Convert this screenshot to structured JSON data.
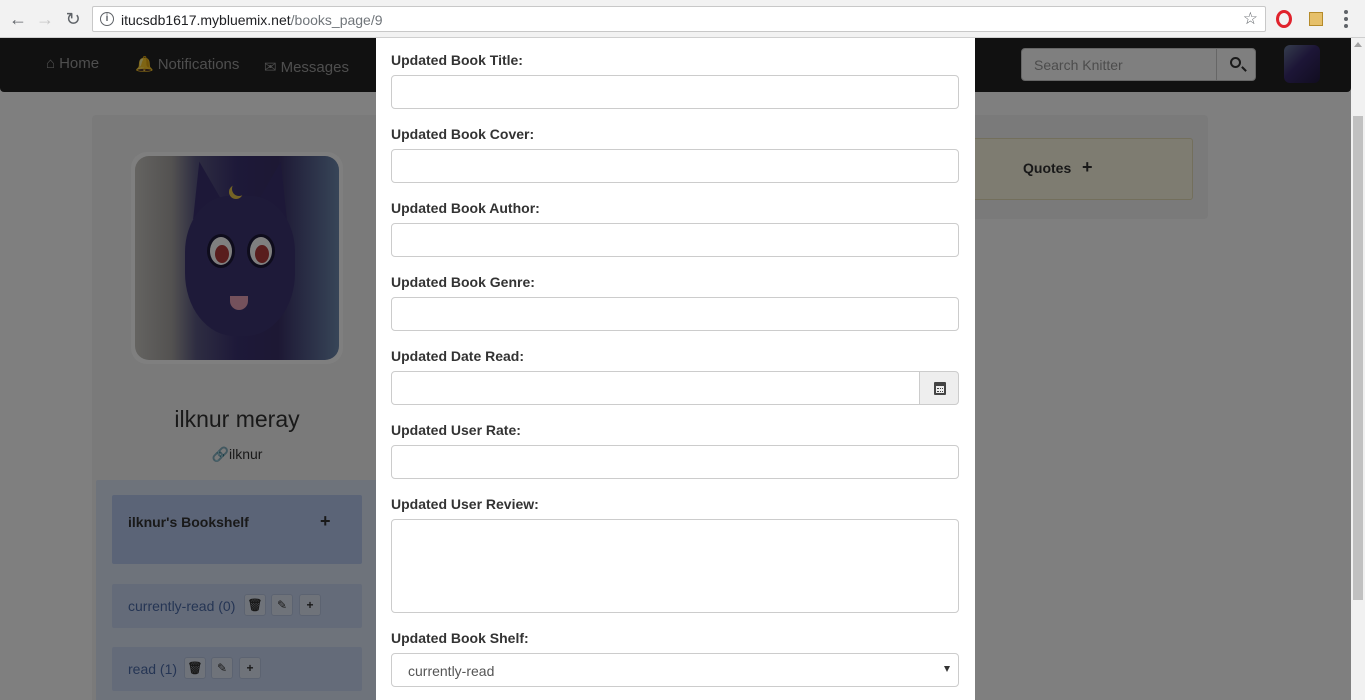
{
  "browser": {
    "url_host": "itucsdb1617.mybluemix.net",
    "url_path": "/books_page/9",
    "back_icon": "arrow-left",
    "forward_icon": "arrow-right",
    "reload_icon": "reload",
    "star_icon": "star"
  },
  "navbar": {
    "home": "Home",
    "notifications": "Notifications",
    "messages": "Messages",
    "search_placeholder": "Search Knitter"
  },
  "profile": {
    "name": "ilknur meray",
    "handle": "ilknur"
  },
  "bookshelf": {
    "title": "ilknur's Bookshelf",
    "add": "+",
    "shelves": [
      {
        "label": "currently-read (0)"
      },
      {
        "label": "read (1)"
      }
    ]
  },
  "quotes": {
    "title": "Quotes",
    "add": "+"
  },
  "modal": {
    "title_label": "Updated Book Title:",
    "cover_label": "Updated Book Cover:",
    "author_label": "Updated Book Author:",
    "genre_label": "Updated Book Genre:",
    "date_label": "Updated Date Read:",
    "rate_label": "Updated User Rate:",
    "review_label": "Updated User Review:",
    "shelf_label": "Updated Book Shelf:",
    "shelf_value": "currently-read"
  },
  "colors": {
    "navbar_bg": "#222222",
    "quotes_bg": "#fcf8e3",
    "shelf_header_bg": "#b7c8ef"
  }
}
